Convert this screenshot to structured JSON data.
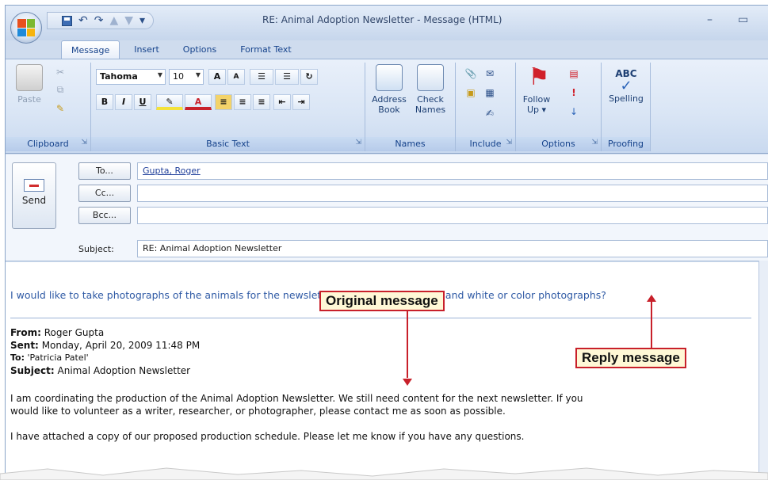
{
  "window": {
    "title": "RE: Animal Adoption Newsletter - Message (HTML)",
    "minimize": "–",
    "maximize": "▭"
  },
  "tabs": [
    "Message",
    "Insert",
    "Options",
    "Format Text"
  ],
  "ribbon": {
    "clipboard": {
      "label": "Clipboard",
      "paste": "Paste"
    },
    "basic_text": {
      "label": "Basic Text",
      "font": "Tahoma",
      "size": "10",
      "bold": "B",
      "italic": "I",
      "underline": "U"
    },
    "names": {
      "label": "Names",
      "address_book": "Address Book",
      "check_names": "Check Names"
    },
    "include": {
      "label": "Include"
    },
    "options": {
      "label": "Options",
      "follow_up": "Follow Up ▾"
    },
    "proofing": {
      "label": "Proofing",
      "spelling": "Spelling",
      "abc": "ABC"
    }
  },
  "header": {
    "send": "Send",
    "to_btn": "To...",
    "cc_btn": "Cc...",
    "bcc_btn": "Bcc...",
    "to_value": "Gupta, Roger",
    "cc_value": "",
    "bcc_value": "",
    "subject_label": "Subject:",
    "subject_value": "RE: Animal Adoption Newsletter"
  },
  "body": {
    "reply": "I would like to take photographs of the animals for the newsletter. Would you like black and white or color photographs?",
    "from_label": "From:",
    "from_value": "Roger Gupta",
    "sent_label": "Sent:",
    "sent_value": "Monday, April 20, 2009 11:48 PM",
    "to_label": "To:",
    "to_value": "'Patricia Patel'",
    "subject_label": "Subject:",
    "subject_value": "Animal Adoption Newsletter",
    "para1_line1": "I am coordinating the production of the Animal Adoption Newsletter. We still need content for the next newsletter. If you",
    "para1_line2": "would like to volunteer as a writer, researcher, or photographer, please contact me as soon as possible.",
    "para2": "I have attached a copy of our proposed production schedule. Please let me know if you have any questions."
  },
  "callouts": {
    "original": "Original message",
    "reply": "Reply message"
  },
  "colors": {
    "accent": "#15428b",
    "callout_border": "#c8202a",
    "callout_fill": "#fff8d6",
    "reply_text": "#2f5aa5"
  }
}
